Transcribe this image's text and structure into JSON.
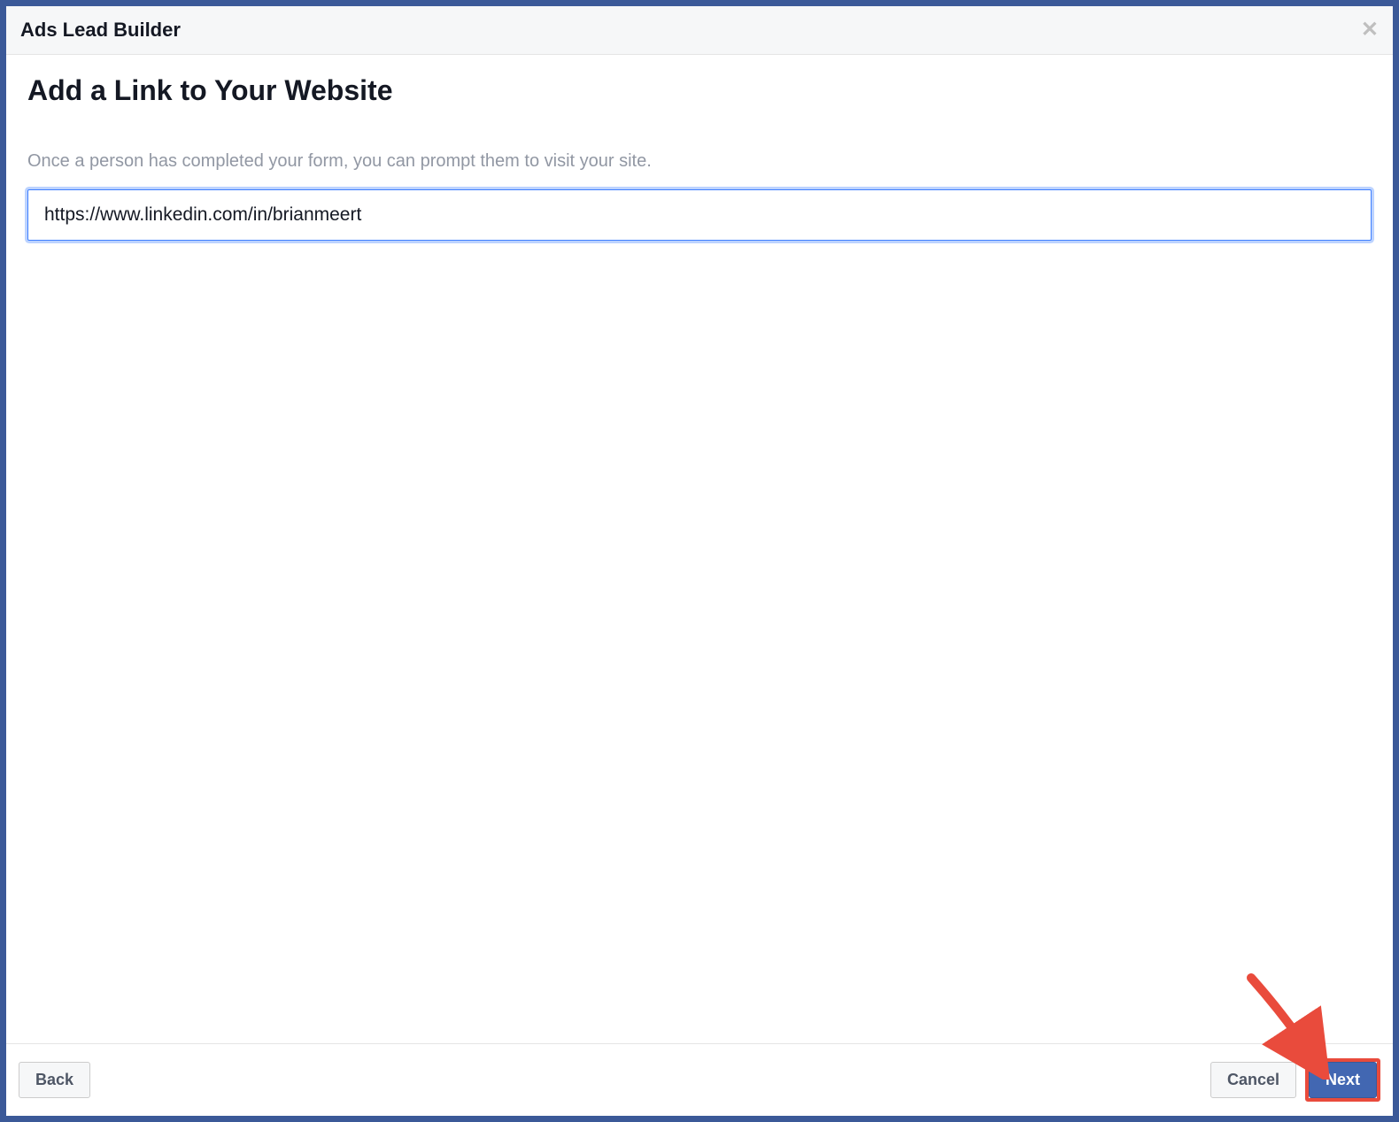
{
  "header": {
    "title": "Ads Lead Builder"
  },
  "main": {
    "page_title": "Add a Link to Your Website",
    "description": "Once a person has completed your form, you can prompt them to visit your site.",
    "url_value": "https://www.linkedin.com/in/brianmeert"
  },
  "footer": {
    "back_label": "Back",
    "cancel_label": "Cancel",
    "next_label": "Next"
  }
}
